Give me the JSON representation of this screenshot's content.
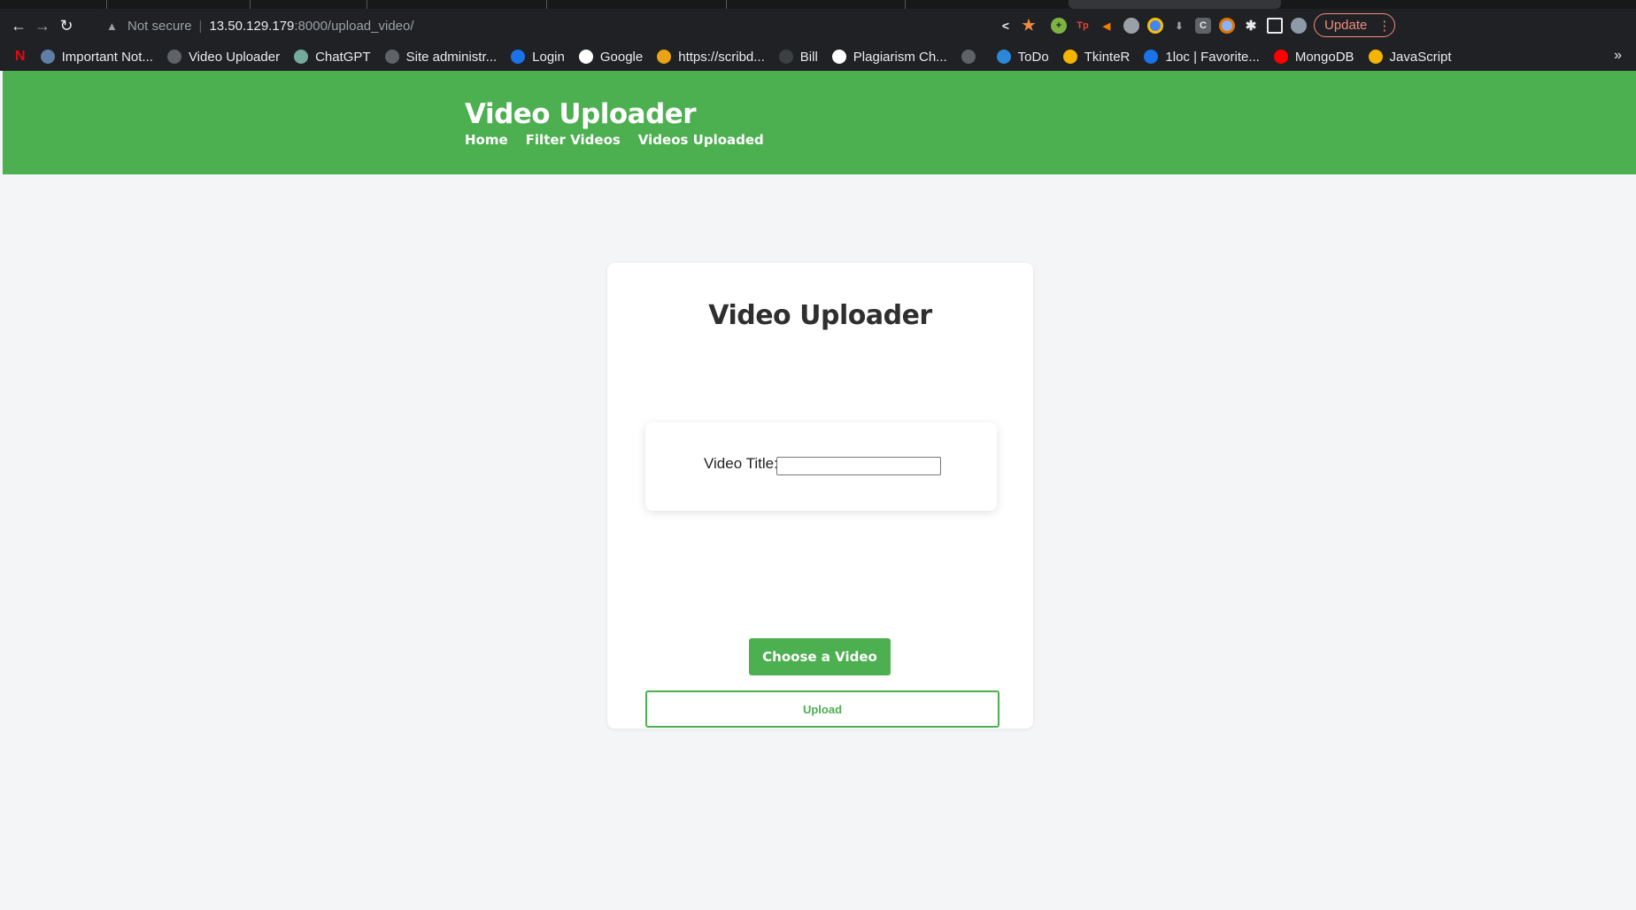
{
  "browser": {
    "back_icon": "←",
    "forward_icon": "→",
    "reload_icon": "↻",
    "security_label": "Not secure",
    "url_host": "13.50.129.179",
    "url_path": ":8000/upload_video/",
    "update_label": "Update",
    "menu_icon": "⋮",
    "bookmarks": [
      {
        "label": "Important Not...",
        "icon": "doc-icon",
        "color": "#5f7fa8"
      },
      {
        "label": "Video Uploader",
        "icon": "globe-icon",
        "color": "#5f6368"
      },
      {
        "label": "ChatGPT",
        "icon": "chatgpt-icon",
        "color": "#74aa9c"
      },
      {
        "label": "Site administr...",
        "icon": "globe-icon",
        "color": "#5f6368"
      },
      {
        "label": "Login",
        "icon": "arrow-icon",
        "color": "#1a73e8"
      },
      {
        "label": "Google",
        "icon": "google-icon",
        "color": "#ffffff"
      },
      {
        "label": "https://scribd...",
        "icon": "scribd-icon",
        "color": "#e8a317"
      },
      {
        "label": "Bill",
        "icon": "bill-icon",
        "color": "#3c4043"
      },
      {
        "label": "Plagiarism Ch...",
        "icon": "sst-icon",
        "color": "#ffffff"
      },
      {
        "label": "",
        "icon": "globe-icon",
        "color": "#5f6368"
      },
      {
        "label": "ToDo",
        "icon": "todo-icon",
        "color": "#2b88d8"
      },
      {
        "label": "TkinteR",
        "icon": "tkinter-icon",
        "color": "#f4b400"
      },
      {
        "label": "1loc | Favorite...",
        "icon": "1loc-icon",
        "color": "#1a73e8"
      },
      {
        "label": "MongoDB",
        "icon": "youtube-icon",
        "color": "#ff0000"
      },
      {
        "label": "JavaScript",
        "icon": "js-icon",
        "color": "#f4b400"
      }
    ],
    "more_bookmarks_icon": "»"
  },
  "site": {
    "title": "Video Uploader",
    "nav": [
      "Home",
      "Filter Videos",
      "Videos Uploaded"
    ]
  },
  "card": {
    "title": "Video Uploader",
    "video_title_label": "Video Title:",
    "video_title_value": "",
    "choose_button": "Choose a Video",
    "upload_button": "Upload"
  },
  "colors": {
    "brand_green": "#4caf50",
    "chrome_dark": "#202124",
    "page_bg": "#f4f5f7"
  }
}
